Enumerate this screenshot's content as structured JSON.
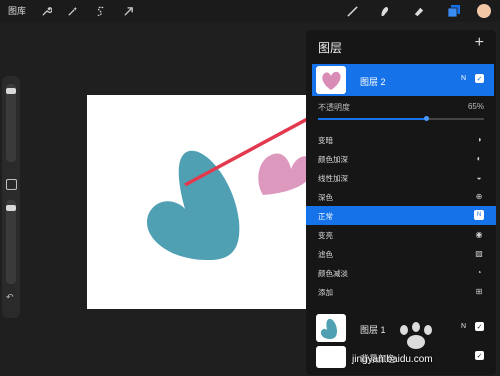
{
  "topbar": {
    "gallery_label": "图库",
    "tools_left": [
      "wrench-icon",
      "magic-wand-icon",
      "selection-s-icon",
      "arrow-cursor-icon"
    ],
    "tools_right": [
      "brush-icon",
      "smudge-icon",
      "eraser-icon",
      "layers-icon",
      "color-swatch-icon"
    ],
    "color_swatch": "#f2c7a6"
  },
  "panel": {
    "title": "图层",
    "add_symbol": "+",
    "active_layer": {
      "name": "图层 2",
      "blend_badge": "N",
      "visible": true
    },
    "opacity": {
      "label": "不透明度",
      "value": "65%",
      "fraction": 0.65
    },
    "blend_modes": [
      {
        "label": "变暗",
        "icon": "◑"
      },
      {
        "label": "颜色加深",
        "icon": "◐"
      },
      {
        "label": "线性加深",
        "icon": "◒"
      },
      {
        "label": "深色",
        "icon": "⊕"
      },
      {
        "label": "正常",
        "icon": "N",
        "selected": true
      },
      {
        "label": "变亮",
        "icon": "◉"
      },
      {
        "label": "滤色",
        "icon": "▨"
      },
      {
        "label": "颜色减淡",
        "icon": "◔"
      },
      {
        "label": "添加",
        "icon": "⊞"
      }
    ],
    "layer1": {
      "name": "图层 1",
      "blend_badge": "N",
      "visible": true
    },
    "background": {
      "name": "背景颜色",
      "visible": true
    }
  },
  "watermark": {
    "text": "jingyan.baidu.com"
  },
  "colors": {
    "accent": "#1572e8",
    "pink_heart": "#d98db6",
    "teal_heart": "#4fa0b3",
    "arrow": "#e2394e"
  }
}
